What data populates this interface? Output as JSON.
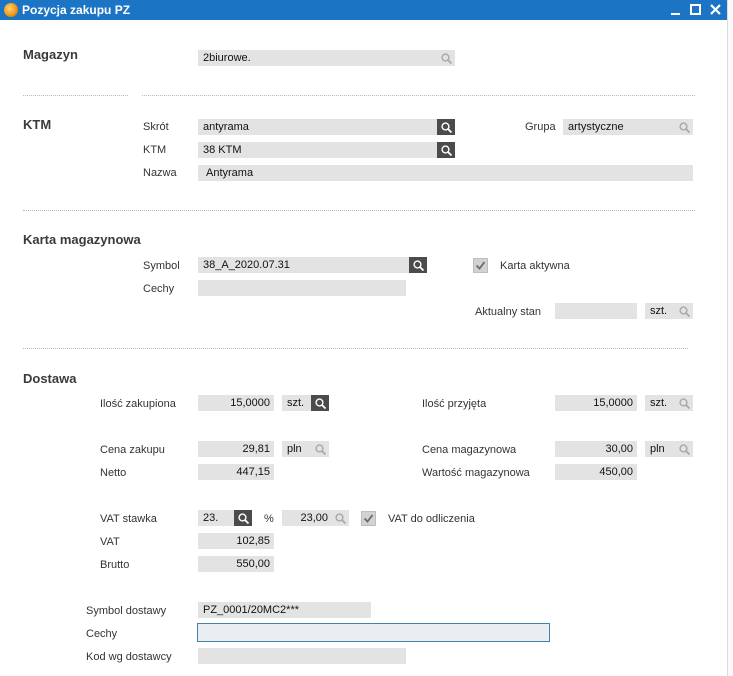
{
  "window": {
    "title": "Pozycja zakupu PZ"
  },
  "magazyn": {
    "section": "Magazyn",
    "value": "2biurowe."
  },
  "ktm": {
    "section": "KTM",
    "skrot_label": "Skrót",
    "skrot_value": "antyrama",
    "grupa_label": "Grupa",
    "grupa_value": "artystyczne",
    "ktm_label": "KTM",
    "ktm_value": "38 KTM",
    "nazwa_label": "Nazwa",
    "nazwa_value": "Antyrama"
  },
  "karta": {
    "section": "Karta magazynowa",
    "symbol_label": "Symbol",
    "symbol_value": "38_A_2020.07.31",
    "aktywna_label": "Karta aktywna",
    "cechy_label": "Cechy",
    "cechy_value": "",
    "stan_label": "Aktualny stan",
    "stan_value": "",
    "stan_unit": "szt."
  },
  "dostawa": {
    "section": "Dostawa",
    "ilosc_zakupiona_label": "Ilość zakupiona",
    "ilosc_zakupiona_value": "15,0000",
    "ilosc_zakupiona_unit": "szt.",
    "ilosc_przyjeta_label": "Ilość przyjęta",
    "ilosc_przyjeta_value": "15,0000",
    "ilosc_przyjeta_unit": "szt.",
    "cena_zakupu_label": "Cena zakupu",
    "cena_zakupu_value": "29,81",
    "cena_zakupu_currency": "pln",
    "cena_mag_label": "Cena magazynowa",
    "cena_mag_value": "30,00",
    "cena_mag_currency": "pln",
    "netto_label": "Netto",
    "netto_value": "447,15",
    "wartosc_mag_label": "Wartość magazynowa",
    "wartosc_mag_value": "450,00",
    "vat_stawka_label": "VAT stawka",
    "vat_stawka_value": "23.",
    "percent_sign": "%",
    "vat_percent_value": "23,00",
    "vat_odliczenia_label": "VAT do odliczenia",
    "vat_label": "VAT",
    "vat_value": "102,85",
    "brutto_label": "Brutto",
    "brutto_value": "550,00",
    "symbol_dostawy_label": "Symbol dostawy",
    "symbol_dostawy_value": "PZ_0001/20MC2***",
    "cechy_label": "Cechy",
    "cechy_value": "",
    "kod_label": "Kod wg dostawcy",
    "kod_value": ""
  }
}
